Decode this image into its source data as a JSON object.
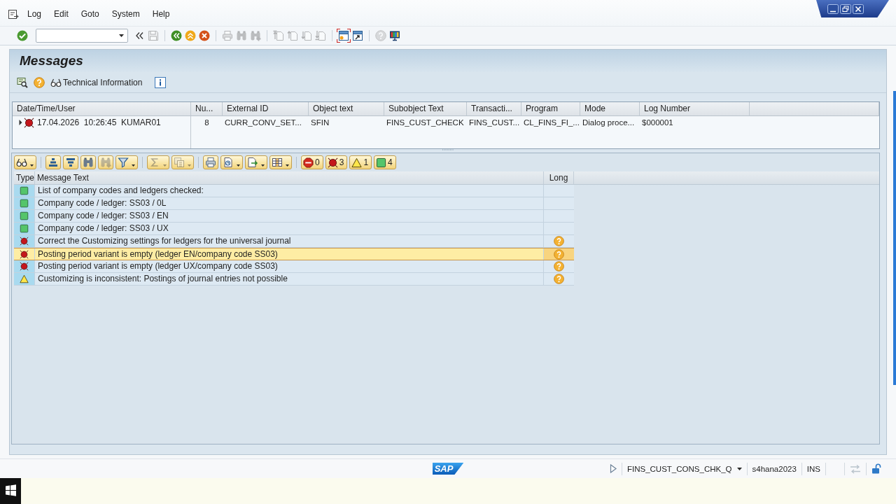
{
  "menu_bar": {
    "items": [
      "Log",
      "Edit",
      "Goto",
      "System",
      "Help"
    ]
  },
  "toolbar": {
    "groups": [
      [
        {
          "kind": "enter",
          "disabled": false,
          "focused": false
        },
        {
          "kind": "command-field",
          "disabled": false,
          "focused": false
        },
        {
          "kind": "collapse",
          "disabled": false,
          "focused": false
        },
        {
          "kind": "save",
          "disabled": true,
          "focused": false
        }
      ],
      [
        {
          "kind": "back",
          "disabled": false,
          "focused": false
        },
        {
          "kind": "exit",
          "disabled": false,
          "focused": false
        },
        {
          "kind": "cancel",
          "disabled": false,
          "focused": false
        }
      ],
      [
        {
          "kind": "print",
          "disabled": true,
          "focused": false
        },
        {
          "kind": "find",
          "disabled": true,
          "focused": false
        },
        {
          "kind": "find-next",
          "disabled": true,
          "focused": false
        }
      ],
      [
        {
          "kind": "first-page",
          "disabled": true,
          "focused": false
        },
        {
          "kind": "previous-page",
          "disabled": true,
          "focused": false
        },
        {
          "kind": "next-page",
          "disabled": true,
          "focused": false
        },
        {
          "kind": "last-page",
          "disabled": true,
          "focused": false
        }
      ],
      [
        {
          "kind": "layout",
          "disabled": false,
          "focused": true
        },
        {
          "kind": "new-session",
          "disabled": false,
          "focused": false
        }
      ],
      [
        {
          "kind": "help",
          "disabled": true,
          "focused": false
        },
        {
          "kind": "customize",
          "disabled": false,
          "focused": false
        }
      ]
    ]
  },
  "title": "Messages",
  "app_toolbar": {
    "buttons": [
      {
        "kind": "detail"
      },
      {
        "kind": "help"
      },
      {
        "kind": "technical-info",
        "label": "Technical Information"
      },
      {
        "kind": "info"
      }
    ]
  },
  "log_table": {
    "columns": [
      "Date/Time/User",
      "Nu...",
      "External ID",
      "Object text",
      "Subobject Text",
      "Transacti...",
      "Program",
      "Mode",
      "Log Number"
    ],
    "rows": [
      {
        "expanded": false,
        "kind": "error",
        "cells": [
          "17.04.2026  10:26:45  KUMAR01",
          "8",
          "CURR_CONV_SET...",
          "SFIN",
          "FINS_CUST_CHECK",
          "FINS_CUST...",
          "CL_FINS_FI_...",
          "Dialog proce...",
          "$000001"
        ]
      }
    ]
  },
  "messages": {
    "toolbar": {
      "groups": [
        [
          {
            "kind": "details",
            "menu": true,
            "disabled": false
          }
        ],
        [
          {
            "kind": "sort-ascending",
            "menu": false,
            "disabled": false
          },
          {
            "kind": "sort-descending",
            "menu": false,
            "disabled": false
          },
          {
            "kind": "find",
            "menu": false,
            "disabled": false
          },
          {
            "kind": "find-next",
            "menu": false,
            "disabled": true
          },
          {
            "kind": "filter",
            "menu": true,
            "disabled": false
          }
        ],
        [
          {
            "kind": "sum",
            "menu": true,
            "disabled": true
          },
          {
            "kind": "subtotals",
            "menu": true,
            "disabled": true
          }
        ],
        [
          {
            "kind": "print",
            "menu": false,
            "disabled": false
          },
          {
            "kind": "view",
            "menu": true,
            "disabled": false
          },
          {
            "kind": "export",
            "menu": true,
            "disabled": false
          },
          {
            "kind": "layout",
            "menu": true,
            "disabled": false
          }
        ]
      ],
      "counts": [
        {
          "kind": "abort",
          "count": "0"
        },
        {
          "kind": "error",
          "count": "3"
        },
        {
          "kind": "warning",
          "count": "1"
        },
        {
          "kind": "success",
          "count": "4"
        }
      ]
    },
    "columns": [
      "Type",
      "Message Text",
      "Long"
    ],
    "rows": [
      {
        "kind": "success",
        "text": "List of company codes and ledgers checked:",
        "long_text": false,
        "selected": false
      },
      {
        "kind": "success",
        "text": "Company code / ledger: SS03 / 0L",
        "long_text": false,
        "selected": false
      },
      {
        "kind": "success",
        "text": "Company code / ledger: SS03 / EN",
        "long_text": false,
        "selected": false
      },
      {
        "kind": "success",
        "text": "Company code / ledger: SS03 / UX",
        "long_text": false,
        "selected": false
      },
      {
        "kind": "error",
        "text": "Correct the Customizing settings for ledgers for the universal journal",
        "long_text": true,
        "selected": false
      },
      {
        "kind": "error",
        "text": "Posting period variant is empty (ledger EN/company code SS03)",
        "long_text": true,
        "selected": true
      },
      {
        "kind": "error",
        "text": "Posting period variant is empty (ledger UX/company code SS03)",
        "long_text": true,
        "selected": false
      },
      {
        "kind": "warning",
        "text": "Customizing is inconsistent: Postings of journal entries not possible",
        "long_text": true,
        "selected": false
      }
    ]
  },
  "status_bar": {
    "logo": "SAP",
    "session": "FINS_CUST_CONS_CHK_Q",
    "server": "s4hana2023",
    "input_mode": "INS"
  }
}
